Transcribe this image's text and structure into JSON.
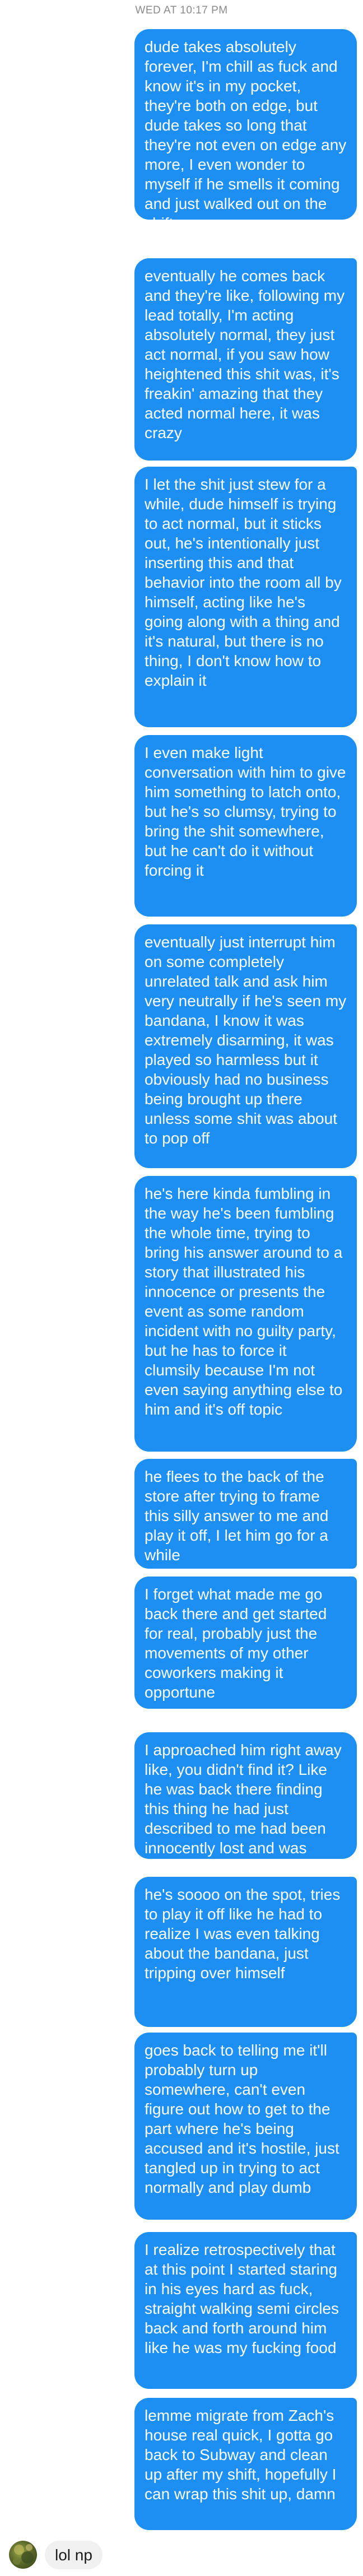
{
  "thread": {
    "timestamp": "WED AT 10:17 PM",
    "outgoing": [
      "dude takes absolutely forever, I'm chill as fuck and know it's in my pocket, they're both on edge, but dude takes so long that they're not even on edge any more, I even wonder to myself if he smells it coming and just walked out on the shift",
      "eventually he comes back and they're like, following my lead totally, I'm acting absolutely normal, they just act normal, if you saw how heightened this shit was, it's freakin' amazing that they acted normal here, it was crazy",
      "I let the shit just stew for a while, dude himself is trying to act normal, but it sticks out, he's intentionally just inserting this and that behavior into the room all by himself, acting like he's going along with a thing and it's natural, but there is no thing, I don't know how to explain it",
      "I even make light conversation with him to give him something to latch onto, but he's so clumsy, trying to bring the shit somewhere, but he can't do it without forcing it",
      "eventually just interrupt him on some completely unrelated talk and ask him very neutrally if he's seen my bandana, I know it was extremely disarming, it was played so harmless but it obviously had no business being brought up there unless some shit was about to pop off",
      "he's here kinda fumbling in the way he's been fumbling the whole time, trying to bring his answer around to a story that illustrated his innocence or presents the event as some random incident with no guilty party, but he has to force it clumsily because I'm not even saying anything else to him and it's off topic",
      "he flees to the back of the store after trying to frame this silly answer to me and play it off, I let him go for a while",
      "I forget what made me go back there and get started for real, probably just the movements of my other coworkers making it opportune",
      "I approached him right away like, you didn't find it? Like he was back there finding this thing he had just described to me had been innocently lost and was going to turn up",
      "he's soooo on the spot, tries to play it off like he had to realize I was even talking about the bandana, just tripping over himself",
      "goes back to telling me it'll probably turn up somewhere, can't even figure out how to get to the part where he's being accused and it's hostile, just tangled up in trying to act normally and play dumb",
      "I realize retrospectively that at this point I started staring in his eyes hard as fuck, straight walking semi circles back and forth around him like he was my fucking food",
      "lemme migrate from Zach's house real quick, I gotta go back to Subway and clean up after my shift, hopefully I can wrap this shit up, damn"
    ],
    "incoming": {
      "text": "lol np",
      "avatar_icon": "avatar-photo-icon"
    },
    "colors": {
      "outgoing_bubble": "#1d8ff2",
      "incoming_bubble": "#f1f0f0",
      "timestamp": "#8a8a8a"
    }
  }
}
